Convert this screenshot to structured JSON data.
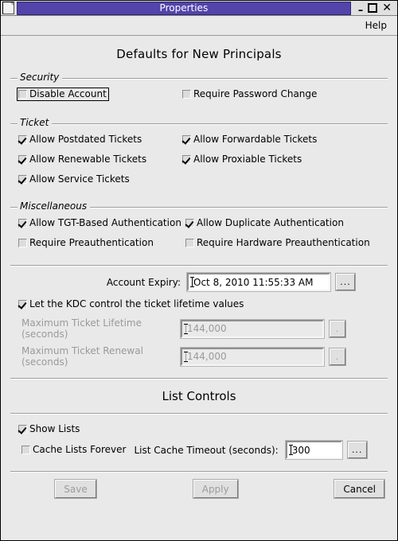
{
  "window": {
    "title": "Properties",
    "sysicon": "window-icon",
    "minimize": "–",
    "maximize": "",
    "close": "✕"
  },
  "menubar": {
    "help": "Help"
  },
  "page_title": "Defaults for New Principals",
  "groups": {
    "security": {
      "label": "Security",
      "items": [
        {
          "label": "Disable Account",
          "checked": false,
          "focused": true
        },
        {
          "label": "Require Password Change",
          "checked": false,
          "focused": false
        }
      ]
    },
    "ticket": {
      "label": "Ticket",
      "items": [
        {
          "label": "Allow Postdated Tickets",
          "checked": true
        },
        {
          "label": "Allow Forwardable Tickets",
          "checked": true
        },
        {
          "label": "Allow Renewable Tickets",
          "checked": true
        },
        {
          "label": "Allow Proxiable Tickets",
          "checked": true
        },
        {
          "label": "Allow Service Tickets",
          "checked": true
        }
      ]
    },
    "miscellaneous": {
      "label": "Miscellaneous",
      "items": [
        {
          "label": "Allow TGT-Based Authentication",
          "checked": true
        },
        {
          "label": "Allow Duplicate Authentication",
          "checked": true
        },
        {
          "label": "Require Preauthentication",
          "checked": false
        },
        {
          "label": "Require Hardware Preauthentication",
          "checked": false
        }
      ]
    }
  },
  "fields": {
    "account_expiry": {
      "label": "Account Expiry:",
      "value": "Oct 8, 2010 11:55:33 AM",
      "button": "...",
      "enabled": true
    },
    "kdc_control": {
      "label": "Let the KDC control the ticket lifetime values",
      "checked": true
    },
    "max_ticket_lifetime": {
      "label": "Maximum Ticket Lifetime (seconds)",
      "value": "144,000",
      "button": ".",
      "enabled": false
    },
    "max_ticket_renewal": {
      "label": "Maximum Ticket Renewal (seconds)",
      "value": "144,000",
      "button": ".",
      "enabled": false
    }
  },
  "list_controls": {
    "title": "List Controls",
    "show_lists": {
      "label": "Show Lists",
      "checked": true
    },
    "cache_forever": {
      "label": "Cache Lists Forever",
      "checked": false
    },
    "timeout": {
      "label": "List Cache Timeout (seconds):",
      "value": "300",
      "button": "...",
      "enabled": true
    }
  },
  "buttons": {
    "save": {
      "label": "Save",
      "enabled": false
    },
    "apply": {
      "label": "Apply",
      "enabled": false
    },
    "cancel": {
      "label": "Cancel",
      "enabled": true
    }
  },
  "colors": {
    "titlebar_accent": "#5145ab",
    "face": "#e9e9e9",
    "field_bg": "#ffffff",
    "disabled_text": "#9a9a9a"
  }
}
